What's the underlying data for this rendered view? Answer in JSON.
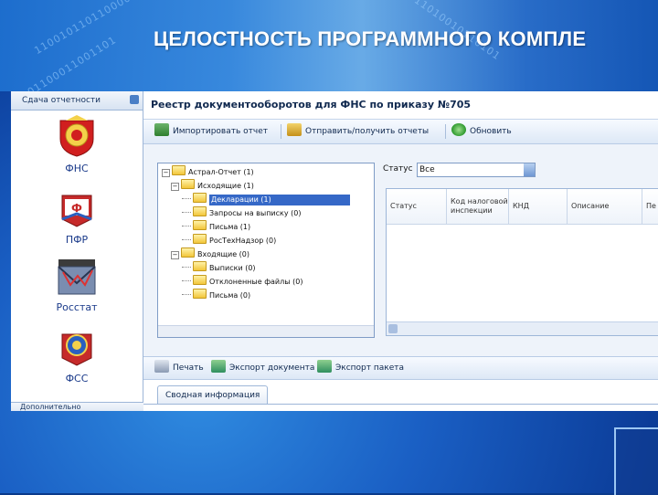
{
  "slide": {
    "title": "ЦЕЛОСТНОСТЬ ПРОГРАММНОГО КОМПЛЕ"
  },
  "decor_digits": [
    "0101100011001101",
    "1100101101100001",
    "0011010010110101"
  ],
  "sidebar": {
    "header": "Сдача отчетности",
    "items": [
      {
        "label": "ФНС",
        "icon": "fns-emblem-icon"
      },
      {
        "label": "ПФР",
        "icon": "pfr-emblem-icon"
      },
      {
        "label": "Росстат",
        "icon": "rosstat-envelope-icon"
      },
      {
        "label": "ФСС",
        "icon": "fss-emblem-icon"
      }
    ],
    "footer": "Дополнительно"
  },
  "main": {
    "title": "Реестр документооборотов для ФНС по приказу №705",
    "toolbar": [
      {
        "label": "Импортировать отчет",
        "icon": "import-icon"
      },
      {
        "label": "Отправить/получить отчеты",
        "icon": "send-receive-icon"
      },
      {
        "label": "Обновить",
        "icon": "refresh-icon"
      }
    ],
    "tree": [
      {
        "label": "Астрал-Отчет (1)",
        "level": 0
      },
      {
        "label": "Исходящие (1)",
        "level": 1
      },
      {
        "label": "Декларации (1)",
        "level": 2,
        "selected": true
      },
      {
        "label": "Запросы на выписку (0)",
        "level": 2
      },
      {
        "label": "Письма (1)",
        "level": 2
      },
      {
        "label": "РосТехНадзор (0)",
        "level": 2
      },
      {
        "label": "Входящие (0)",
        "level": 1
      },
      {
        "label": "Выписки (0)",
        "level": 2
      },
      {
        "label": "Отклоненные файлы (0)",
        "level": 2
      },
      {
        "label": "Письма (0)",
        "level": 2
      }
    ],
    "status": {
      "label": "Статус",
      "value": "Все"
    },
    "grid_columns": [
      "Статус",
      "Код налоговой инспекции",
      "КНД",
      "Описание",
      "Пе"
    ],
    "bottom_toolbar": [
      {
        "label": "Печать",
        "icon": "print-icon"
      },
      {
        "label": "Экспорт документа",
        "icon": "export-document-icon"
      },
      {
        "label": "Экспорт пакета",
        "icon": "export-package-icon"
      }
    ],
    "tab": "Сводная информация"
  }
}
